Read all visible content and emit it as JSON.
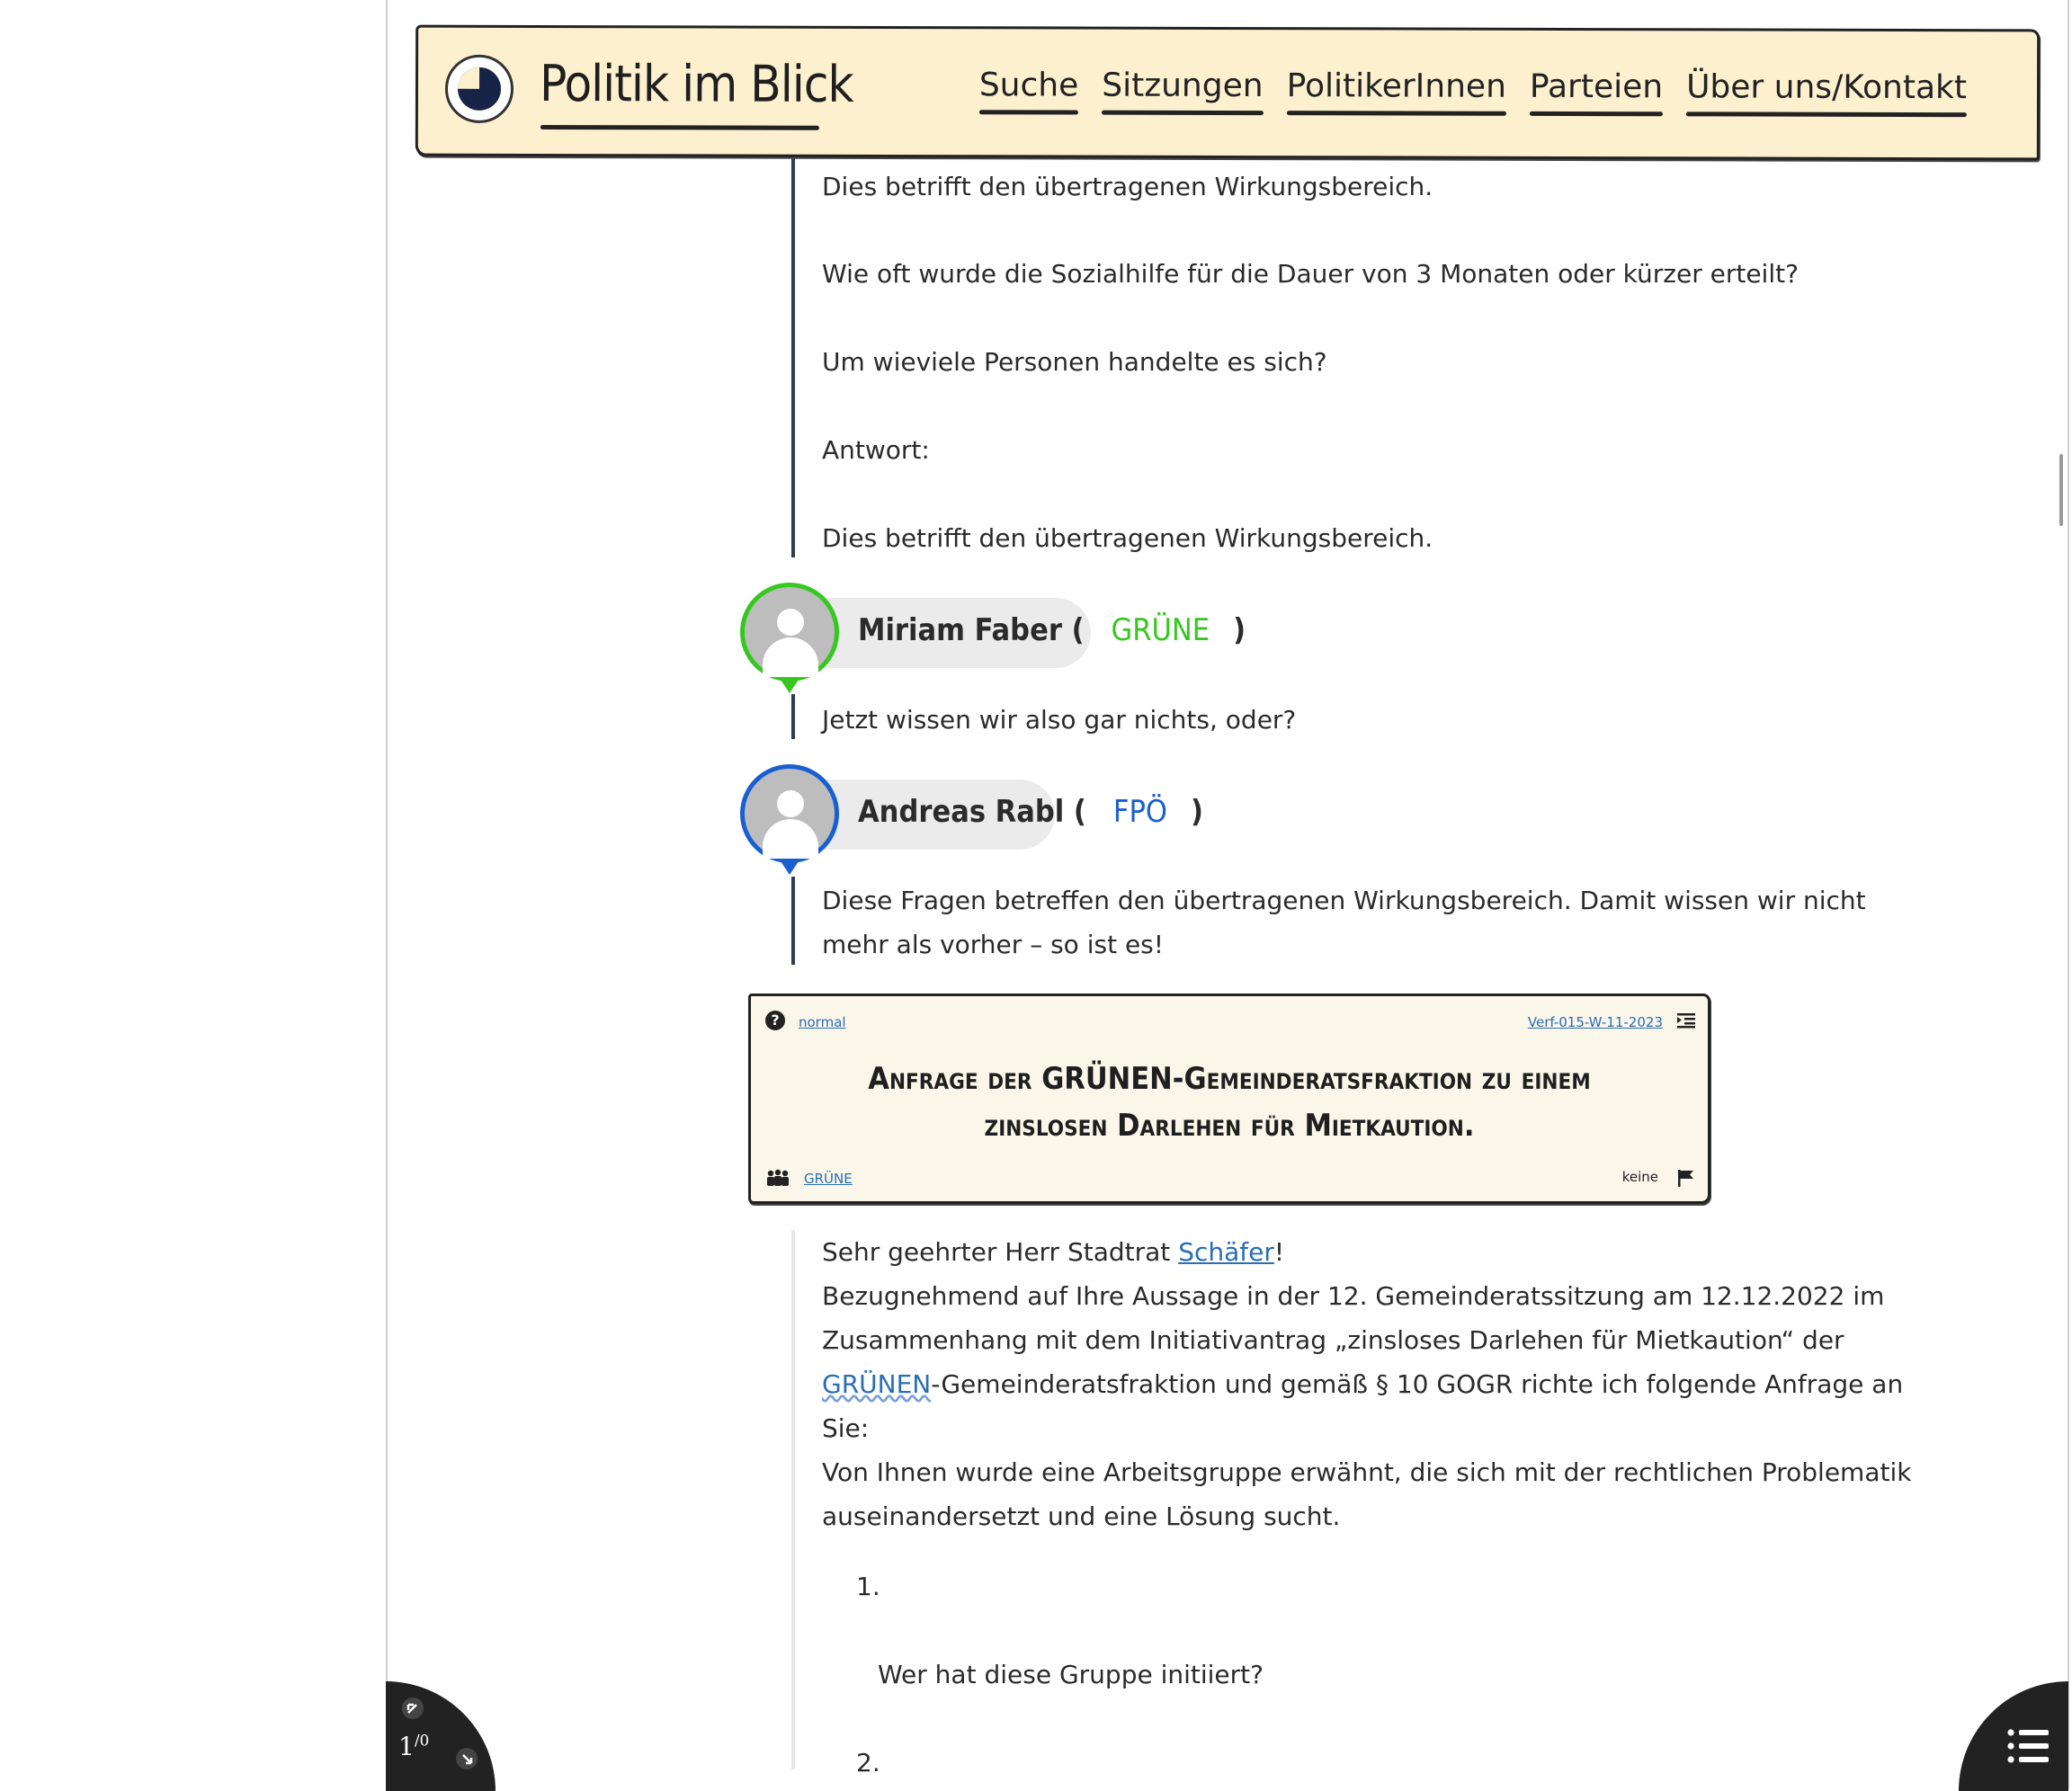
{
  "header": {
    "brand": "Politik im Blick",
    "nav": [
      "Suche",
      "Sitzungen",
      "PolitikerInnen",
      "Parteien",
      "Über uns/Kontakt"
    ]
  },
  "answer_block": {
    "p1": "Dies betrifft den übertragenen Wirkungsbereich.",
    "p2": "Wie oft wurde die Sozialhilfe für die Dauer von 3 Monaten oder kürzer erteilt?",
    "p3": "Um wieviele Personen handelte es sich?",
    "p4": "Antwort:",
    "p5": "Dies betrifft den übertragenen Wirkungsbereich."
  },
  "comments": [
    {
      "name": "Miriam Faber (",
      "party": "GRÜNE",
      "close": ")",
      "party_color": "#36c81f",
      "text": "Jetzt wissen wir also gar nichts, oder?"
    },
    {
      "name": "Andreas Rabl (",
      "party": "FPÖ",
      "close": ")",
      "party_color": "#1a5fd0",
      "text_line1": "Diese Fragen betreffen den übertragenen Wirkungsbereich. Damit wissen wir nicht",
      "text_line2": "mehr als vorher – so ist es!"
    }
  ],
  "card": {
    "priority": "normal",
    "reference": "Verf-015-W-11-2023",
    "title_line1": "Anfrage der GRÜNEN-Gemeinderatsfraktion zu einem",
    "title_line2": "zinslosen Darlehen für Mietkaution.",
    "party": "GRÜNE",
    "tag": "keine",
    "icons": {
      "priority": "question-icon",
      "toc": "list-indent-icon",
      "group": "people-icon",
      "flag": "flag-icon"
    }
  },
  "letter": {
    "salutation_pre": "Sehr geehrter Herr Stadtrat ",
    "salutation_link": "Schäfer",
    "salutation_post": "!",
    "l2": "Bezugnehmend auf Ihre Aussage in der 12. Gemeinderatssitzung am 12.12.2022 im",
    "l3": "Zusammenhang mit dem Initiativantrag „zinsloses Darlehen für Mietkaution“ der",
    "l4_link": "GRÜNEN",
    "l4_rest": "-Gemeinderatsfraktion und gemäß § 10 GOGR richte ich folgende Anfrage an",
    "l5": "Sie:",
    "l6": "Von Ihnen wurde eine Arbeitsgruppe erwähnt, die sich mit der rechtlichen Problematik",
    "l7": "auseinandersetzt und eine Lösung sucht.",
    "item1_num": "1.",
    "item1_text": "Wer hat diese Gruppe initiiert?",
    "item2_num": "2."
  },
  "pager": {
    "current": "1",
    "total": "/0"
  }
}
